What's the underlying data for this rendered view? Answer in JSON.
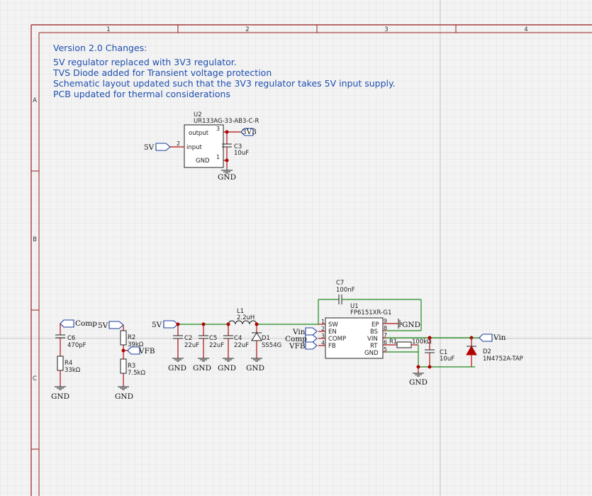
{
  "frame": {
    "columns": [
      "1",
      "2",
      "3",
      "4"
    ],
    "rows": [
      "A",
      "B",
      "C"
    ]
  },
  "notes": {
    "heading": "Version 2.0 Changes:",
    "lines": [
      "5V regulator replaced with 3V3 regulator.",
      "TVS Diode added for Transient voltage protection",
      "Schematic layout updated such that the 3V3 regulator takes 5V input supply.",
      "PCB updated for thermal considerations"
    ]
  },
  "regulator": {
    "ref": "U2",
    "part": "UR133AG-33-AB3-C-R",
    "pins": {
      "output": "output",
      "input": "input",
      "gnd": "GND"
    },
    "pin_numbers": {
      "output": "3",
      "input": "2",
      "gnd": "1"
    },
    "net_in": "5V",
    "net_out": "3V3",
    "cap_ref": "C3",
    "cap_value": "10uF",
    "ground": "GND"
  },
  "buck": {
    "ic_ref": "U1",
    "ic_part": "FP6151XR-G1",
    "left_pins": [
      {
        "num": "1",
        "name": "SW"
      },
      {
        "num": "2",
        "name": "EN"
      },
      {
        "num": "3",
        "name": "COMP"
      },
      {
        "num": "4",
        "name": "FB"
      }
    ],
    "right_pins": [
      {
        "num": "9",
        "name": "EP"
      },
      {
        "num": "8",
        "name": "BS"
      },
      {
        "num": "7",
        "name": "VIN"
      },
      {
        "num": "6",
        "name": "RT"
      },
      {
        "num": "5",
        "name": "GND"
      }
    ],
    "left_nets": [
      "Vin",
      "Comp",
      "VFB"
    ],
    "bs_net": "GND",
    "c7_ref": "C7",
    "c7_value": "100nF",
    "l1_ref": "L1",
    "l1_value": "2.2uH",
    "c2_ref": "C2",
    "c2_value": "22uF",
    "c5_ref": "C5",
    "c5_value": "22uF",
    "c4_ref": "C4",
    "c4_value": "22uF",
    "d1_ref": "D1",
    "d1_value": "SS54G",
    "r1_ref": "R1",
    "r1_value": "100kΩ",
    "c1_ref": "C1",
    "c1_value": "10uF",
    "d2_ref": "D2",
    "d2_value": "1N4752A-TAP",
    "vin_net": "Vin",
    "supply_net": "5V",
    "ground": "GND"
  },
  "compensation": {
    "net": "Comp",
    "c6_ref": "C6",
    "c6_value": "470pF",
    "r4_ref": "R4",
    "r4_value": "33kΩ",
    "ground": "GND"
  },
  "feedback": {
    "supply_net": "5V",
    "r2_ref": "R2",
    "r2_value": "39kΩ",
    "fb_net": "VFB",
    "r3_ref": "R3",
    "r3_value": "7.5kΩ",
    "ground": "GND"
  }
}
